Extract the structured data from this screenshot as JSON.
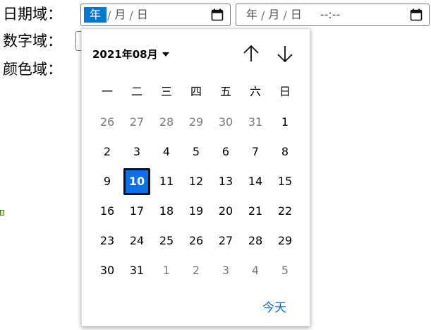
{
  "labels": {
    "date_field": "日期域：",
    "number_field": "数字域：",
    "color_field": "颜色域："
  },
  "date_input_1": {
    "year": "年",
    "month": "月",
    "day": "日",
    "sep": "/",
    "icon": "calendar-icon"
  },
  "date_input_2": {
    "year": "年",
    "month": "月",
    "day": "日",
    "sep": "/",
    "time": "--:--",
    "icon": "calendar-icon"
  },
  "picker": {
    "month_label": "2021年08月",
    "prev_icon": "arrow-up-icon",
    "next_icon": "arrow-down-icon",
    "weekdays": [
      "一",
      "二",
      "三",
      "四",
      "五",
      "六",
      "日"
    ],
    "weeks": [
      [
        "26",
        "27",
        "28",
        "29",
        "30",
        "31",
        "1"
      ],
      [
        "2",
        "3",
        "4",
        "5",
        "6",
        "7",
        "8"
      ],
      [
        "9",
        "10",
        "11",
        "12",
        "13",
        "14",
        "15"
      ],
      [
        "16",
        "17",
        "18",
        "19",
        "20",
        "21",
        "22"
      ],
      [
        "23",
        "24",
        "25",
        "26",
        "27",
        "28",
        "29"
      ],
      [
        "30",
        "31",
        "1",
        "2",
        "3",
        "4",
        "5"
      ]
    ],
    "selected_day": "10",
    "today_label": "今天"
  },
  "colors": {
    "accent": "#0e6ee6",
    "link": "#0b6bcb",
    "selected_segment": "#0078d4"
  }
}
